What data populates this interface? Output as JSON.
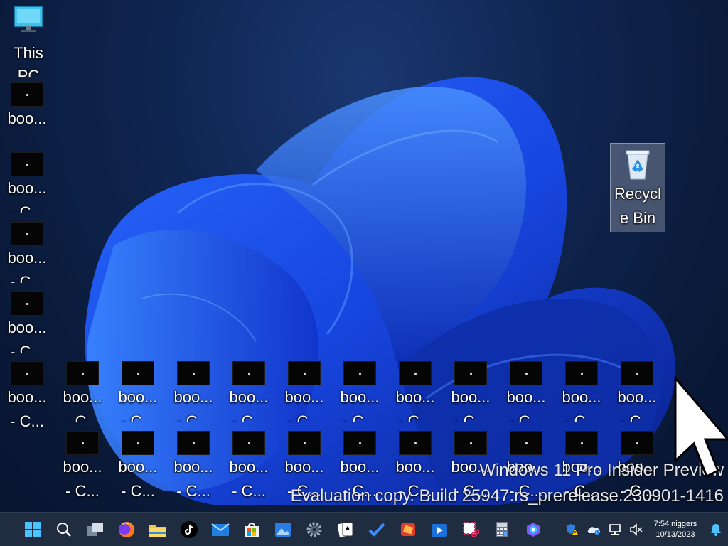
{
  "desktop": {
    "this_pc": {
      "line1": "This",
      "line2": "PC"
    },
    "recycle_bin": {
      "line1": "Recycl",
      "line2": "e Bin"
    },
    "file_label_1": "boo...",
    "file_label_2": "- C...",
    "file_label_2_partial": "- C..."
  },
  "watermark": {
    "line1": "Windows 11 Pro Insider Preview",
    "line2": "Evaluation copy. Build 25947.rs_prerelease.230901-1416"
  },
  "taskbar": {
    "apps": [
      "start-icon",
      "search-icon",
      "task-view-icon",
      "firefox-icon",
      "file-explorer-icon",
      "tiktok-icon",
      "mail-icon",
      "store-icon",
      "photos-icon",
      "settings-icon",
      "solitaire-icon",
      "todo-icon",
      "game-icon",
      "media-player-icon",
      "snipping-tool-icon",
      "calculator-icon",
      "copilot-icon"
    ],
    "tray": [
      "defender-warning-icon",
      "onedrive-icon",
      "network-icon",
      "volume-muted-icon"
    ],
    "time": "7:54 niggers",
    "date": "10/13/2023",
    "notification_icon": "bell-icon"
  }
}
